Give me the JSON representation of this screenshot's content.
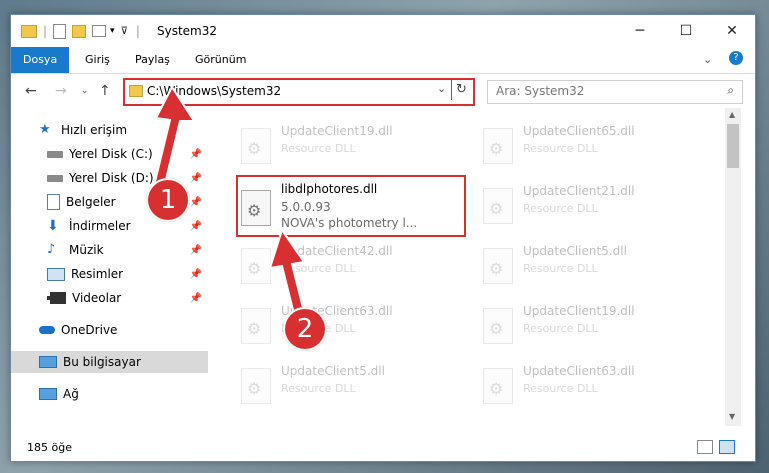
{
  "window": {
    "title": "System32"
  },
  "ribbon": {
    "tabs": [
      "Dosya",
      "Giriş",
      "Paylaş",
      "Görünüm"
    ]
  },
  "address": {
    "path": "C:\\Windows\\System32"
  },
  "search": {
    "placeholder": "Ara: System32"
  },
  "sidebar": {
    "items": [
      {
        "label": "Hızlı erişim",
        "icon": "star-icon"
      },
      {
        "label": "Yerel Disk (C:)",
        "icon": "drive-icon"
      },
      {
        "label": "Yerel Disk (D:)",
        "icon": "drive-icon"
      },
      {
        "label": "Belgeler",
        "icon": "document-icon"
      },
      {
        "label": "İndirmeler",
        "icon": "download-icon"
      },
      {
        "label": "Müzik",
        "icon": "music-icon"
      },
      {
        "label": "Resimler",
        "icon": "picture-icon"
      },
      {
        "label": "Videolar",
        "icon": "video-icon"
      },
      {
        "label": "OneDrive",
        "icon": "cloud-icon"
      },
      {
        "label": "Bu bilgisayar",
        "icon": "computer-icon"
      },
      {
        "label": "Ağ",
        "icon": "network-icon"
      }
    ]
  },
  "files": {
    "highlighted": {
      "name": "libdlphotores.dll",
      "version": "5.0.0.93",
      "description": "NOVA's photometry l..."
    },
    "left": [
      {
        "name": "UpdateClient19.dll",
        "type": "Resource DLL"
      },
      {
        "name": "UpdateClient42.dll",
        "type": "Resource DLL"
      },
      {
        "name": "UpdateClient63.dll",
        "type": "Resource DLL"
      },
      {
        "name": "UpdateClient5.dll",
        "type": "Resource DLL"
      }
    ],
    "right": [
      {
        "name": "UpdateClient65.dll",
        "type": "Resource DLL"
      },
      {
        "name": "UpdateClient21.dll",
        "type": "Resource DLL"
      },
      {
        "name": "UpdateClient5.dll",
        "type": "Resource DLL"
      },
      {
        "name": "UpdateClient19.dll",
        "type": "Resource DLL"
      },
      {
        "name": "UpdateClient63.dll",
        "type": "Resource DLL"
      }
    ]
  },
  "status": {
    "count": "185 öğe"
  },
  "annotations": {
    "step1": "1",
    "step2": "2",
    "color": "#d83030"
  }
}
